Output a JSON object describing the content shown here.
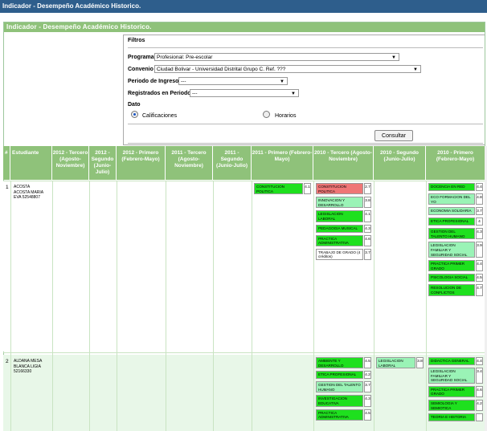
{
  "window_title": "Indicador - Desempeño Académico Historico.",
  "panel_title": "Indicador - Desempeño Académico Historico.",
  "filters": {
    "legend": "Filtros",
    "programa_label": "Programa",
    "programa_value": "Profesional: Pre-escolar",
    "convenio_label": "Convenio",
    "convenio_value": "Ciudad Bolivar - Universidad Distrital Grupo C. Ref. ???",
    "periodo_label": "Periodo de Ingreso",
    "periodo_value": "---",
    "registrados_label": "Registrados en Periodo",
    "registrados_value": "---",
    "dato_label": "Dato",
    "opt_calificaciones": "Calificaciones",
    "opt_horarios": "Horarios",
    "consultar_label": "Consultar"
  },
  "table": {
    "headers": [
      "#",
      "Estudiante",
      "2012 - Tercero (Agosto-Noviembre)",
      "2012 - Segundo (Junio-Julio)",
      "2012 - Primero (Febrero-Mayo)",
      "2011 - Tercero (Agosto-Noviembre)",
      "2011 - Segundo (Junio-Julio)",
      "2011 - Primero (Febrero-Mayo)",
      "2010 - Tercero (Agosto-Noviembre)",
      "2010 - Segundo (Junio-Julio)",
      "2010 - Primero (Febrero-Mayo)"
    ],
    "rows": [
      {
        "num": "1",
        "student": "ACOSTA ACOSTA MARIA EVA 52548807",
        "c2011_1": [
          {
            "name": "CONSTITUCION POLITICA",
            "grade": "4.1",
            "color": "green"
          }
        ],
        "c2010_3": [
          {
            "name": "CONSTITUCION POLITICA",
            "grade": "2.7",
            "color": "red"
          },
          {
            "name": "INNOVACION Y DESARROLLO EMPRESARIAL",
            "grade": "3.8",
            "color": "pale"
          },
          {
            "name": "LEGISLACION LABORAL",
            "grade": "4.1",
            "color": "green"
          },
          {
            "name": "PEDAGOGIA MUSICAL",
            "grade": "4.3",
            "color": "green"
          },
          {
            "name": "PRACTICA ADMINISTRATIVA",
            "grade": "4.6",
            "color": "green"
          },
          {
            "name": "TRABAJO DE GRADO (4 créditos)",
            "grade": "3.7",
            "color": "white"
          }
        ],
        "c2010_1": [
          {
            "name": "DOCENCIA EN RED",
            "grade": "4.4",
            "color": "green"
          },
          {
            "name": "ECO FORMACION DEL YO",
            "grade": "4.8",
            "color": "pale"
          },
          {
            "name": "ECONOMIA SOLIDARIA",
            "grade": "3.7",
            "color": "pale"
          },
          {
            "name": "ETICA PROFESIONAL",
            "grade": "4",
            "color": "green"
          },
          {
            "name": "GESTION DEL TALENTO HUMANO",
            "grade": "4.3",
            "color": "green"
          },
          {
            "name": "LEGISLACION FAMILIAR Y SEGURIDAD SOCIAL",
            "grade": "3.9",
            "color": "pale"
          },
          {
            "name": "PRACTICA PRIMER GRADO",
            "grade": "4.4",
            "color": "green"
          },
          {
            "name": "PSICOLOGIA SOCIAL",
            "grade": "4.5",
            "color": "green"
          },
          {
            "name": "RESOLUCION DE CONFLICTOS",
            "grade": "4.7",
            "color": "green"
          }
        ]
      },
      {
        "num": "2",
        "student": "ALDANA MESA BLANCA LIGIA 52166330",
        "c2010_3": [
          {
            "name": "AMBIENTE Y DESARROLLO",
            "grade": "4.5",
            "color": "green"
          },
          {
            "name": "ETICA PROFESIONAL",
            "grade": "4.2",
            "color": "green"
          },
          {
            "name": "GESTION DEL TALENTO HUMANO",
            "grade": "3.7",
            "color": "pale"
          },
          {
            "name": "INVESTIGACION EDUCATIVA",
            "grade": "4.3",
            "color": "green"
          },
          {
            "name": "PRACTICA ADMINISTRATIVA",
            "grade": "4.5",
            "color": "green"
          }
        ],
        "c2010_2": [
          {
            "name": "LEGISLACION LABORAL",
            "grade": "3.8",
            "color": "pale"
          }
        ],
        "c2010_1": [
          {
            "name": "DIDACTICA GENERAL",
            "grade": "4.4",
            "color": "green"
          },
          {
            "name": "LEGISLACION FAMILIAR Y SEGURIDAD SOCIAL",
            "grade": "3.4",
            "color": "pale"
          },
          {
            "name": "PRACTICA PRIMER GRADO",
            "grade": "4.6",
            "color": "green"
          },
          {
            "name": "SEMIOLOGIA Y SEMIOTICA",
            "grade": "4.2",
            "color": "green"
          },
          {
            "name": "TEORIA E HISTORIA",
            "grade": "",
            "color": "green"
          }
        ]
      }
    ]
  }
}
